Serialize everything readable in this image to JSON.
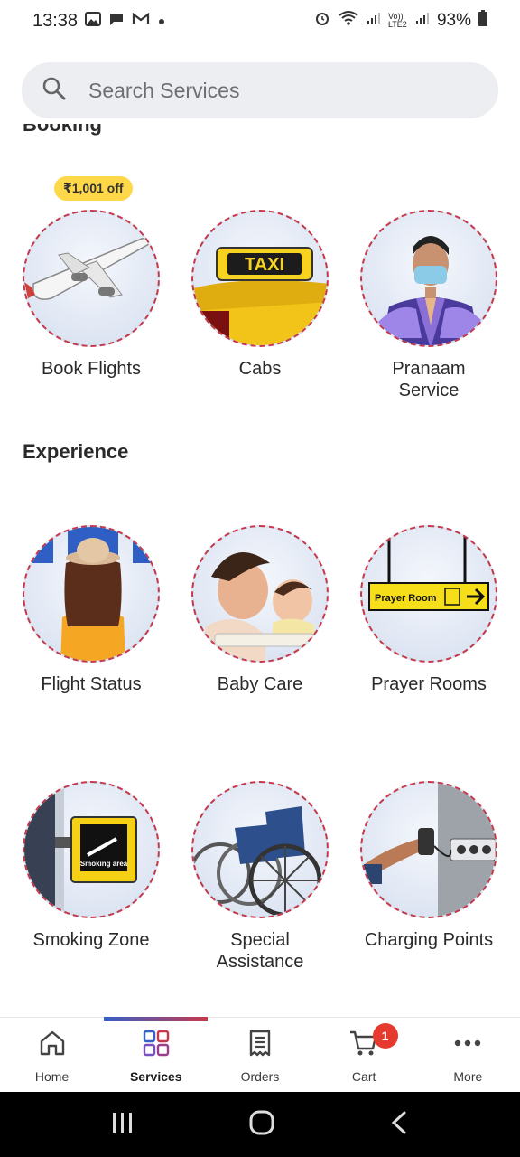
{
  "status_bar": {
    "time": "13:38",
    "network_label": "Vo)) LTE2",
    "battery": "93%"
  },
  "search": {
    "placeholder": "Search Services"
  },
  "sections": {
    "booking": {
      "title": "Booking",
      "items": [
        {
          "label": "Book Flights",
          "badge": "₹1,001 off",
          "icon": "airplane-icon"
        },
        {
          "label": "Cabs",
          "icon": "taxi-icon"
        },
        {
          "label": "Pranaam\nService",
          "icon": "greeter-icon"
        }
      ]
    },
    "experience": {
      "title": "Experience",
      "items": [
        {
          "label": "Flight Status",
          "icon": "departure-board-icon"
        },
        {
          "label": "Baby Care",
          "icon": "baby-care-icon"
        },
        {
          "label": "Prayer Rooms",
          "icon": "prayer-room-sign-icon",
          "sign_text": "Prayer Room"
        },
        {
          "label": "Smoking Zone",
          "icon": "smoking-area-icon",
          "sign_text": "Smoking area"
        },
        {
          "label": "Special\nAssistance",
          "icon": "wheelchair-icon"
        },
        {
          "label": "Charging Points",
          "icon": "charging-point-icon"
        }
      ]
    }
  },
  "bottom_nav": {
    "items": [
      {
        "label": "Home",
        "icon": "home-icon"
      },
      {
        "label": "Services",
        "icon": "grid-icon",
        "active": true
      },
      {
        "label": "Orders",
        "icon": "receipt-icon"
      },
      {
        "label": "Cart",
        "icon": "cart-icon",
        "badge": "1"
      },
      {
        "label": "More",
        "icon": "more-dots-icon"
      }
    ]
  },
  "colors": {
    "accent_blue": "#3461c8",
    "accent_red": "#c8384d",
    "badge_yellow": "#ffd84a",
    "cart_badge": "#e63a2e"
  }
}
